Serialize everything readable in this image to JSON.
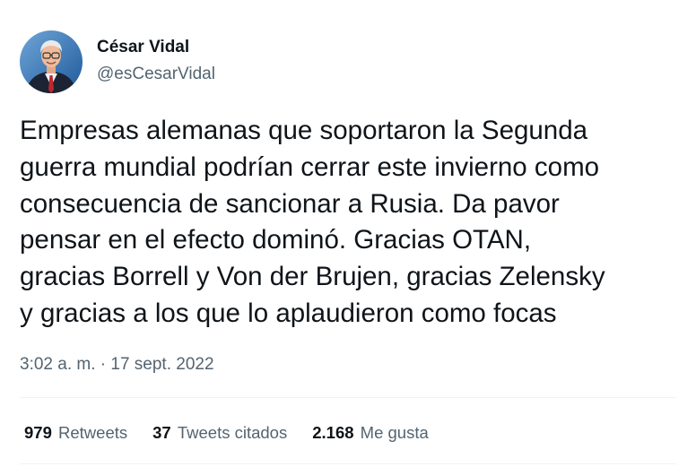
{
  "author": {
    "name": "César Vidal",
    "handle": "@esCesarVidal",
    "avatar_icon": "profile-photo-man-with-glasses"
  },
  "tweet": {
    "text_lines": [
      "Empresas alemanas que soportaron la Segunda",
      "guerra mundial podrían cerrar este invierno como",
      "consecuencia de sancionar a Rusia. Da pavor",
      "pensar en el efecto dominó. Gracias OTAN,",
      "gracias Borrell y Von der Brujen, gracias Zelensky",
      "y gracias a los que lo aplaudieron como focas"
    ],
    "time": "3:02 a. m.",
    "separator": "·",
    "date": "17 sept. 2022"
  },
  "stats": {
    "retweets_count": "979",
    "retweets_label": "Retweets",
    "quotes_count": "37",
    "quotes_label": "Tweets citados",
    "likes_count": "2.168",
    "likes_label": "Me gusta"
  },
  "colors": {
    "text_primary": "#0f1419",
    "text_secondary": "#536471",
    "divider": "#eff3f4"
  }
}
